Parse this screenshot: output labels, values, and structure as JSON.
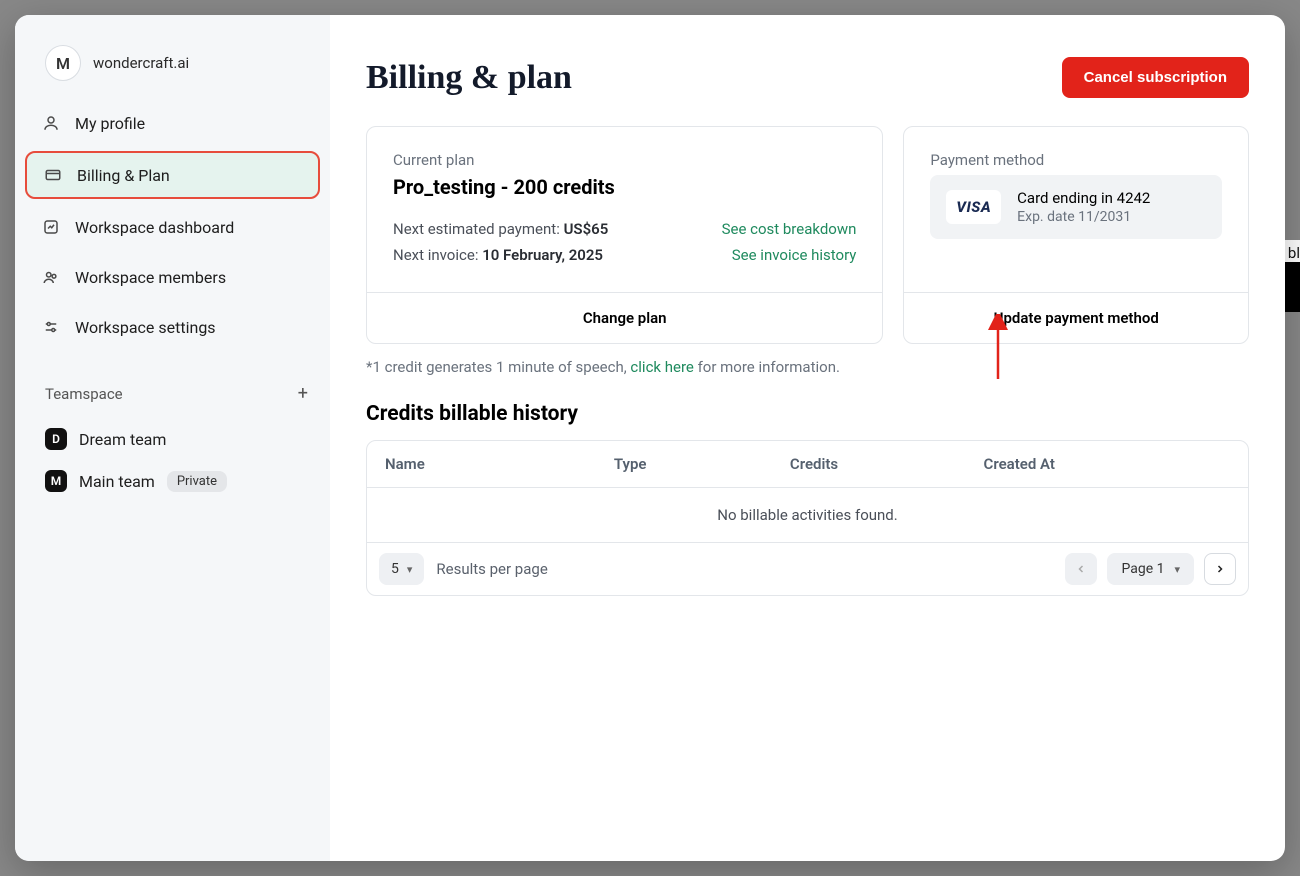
{
  "user": {
    "avatar_initial": "M",
    "email": "wondercraft.ai"
  },
  "sidebar": {
    "items": [
      {
        "label": "My profile"
      },
      {
        "label": "Billing & Plan"
      },
      {
        "label": "Workspace dashboard"
      },
      {
        "label": "Workspace members"
      },
      {
        "label": "Workspace settings"
      }
    ]
  },
  "teamspace": {
    "header": "Teamspace",
    "items": [
      {
        "initial": "D",
        "label": "Dream team",
        "tag": ""
      },
      {
        "initial": "M",
        "label": "Main team",
        "tag": "Private"
      }
    ]
  },
  "page": {
    "title": "Billing & plan",
    "cancel_button": "Cancel subscription"
  },
  "plan_card": {
    "label": "Current plan",
    "name": "Pro_testing - 200 credits",
    "next_payment_label": "Next estimated payment: ",
    "next_payment_value": "US$65",
    "next_invoice_label": "Next invoice: ",
    "next_invoice_value": "10 February, 2025",
    "link_cost": "See cost breakdown",
    "link_invoice": "See invoice history",
    "footer": "Change plan"
  },
  "payment_card": {
    "label": "Payment method",
    "brand": "VISA",
    "card_line": "Card ending in 4242",
    "exp_line": "Exp. date 11/2031",
    "footer": "Update payment method"
  },
  "credit_note": {
    "prefix": "*1 credit generates 1 minute of speech, ",
    "link": "click here",
    "suffix": " for more information."
  },
  "history": {
    "title": "Credits billable history",
    "columns": {
      "name": "Name",
      "type": "Type",
      "credits": "Credits",
      "created": "Created At"
    },
    "empty": "No billable activities found.",
    "per_page_value": "5",
    "per_page_label": "Results per page",
    "page_label": "Page 1"
  },
  "background": {
    "hint": "bl"
  }
}
